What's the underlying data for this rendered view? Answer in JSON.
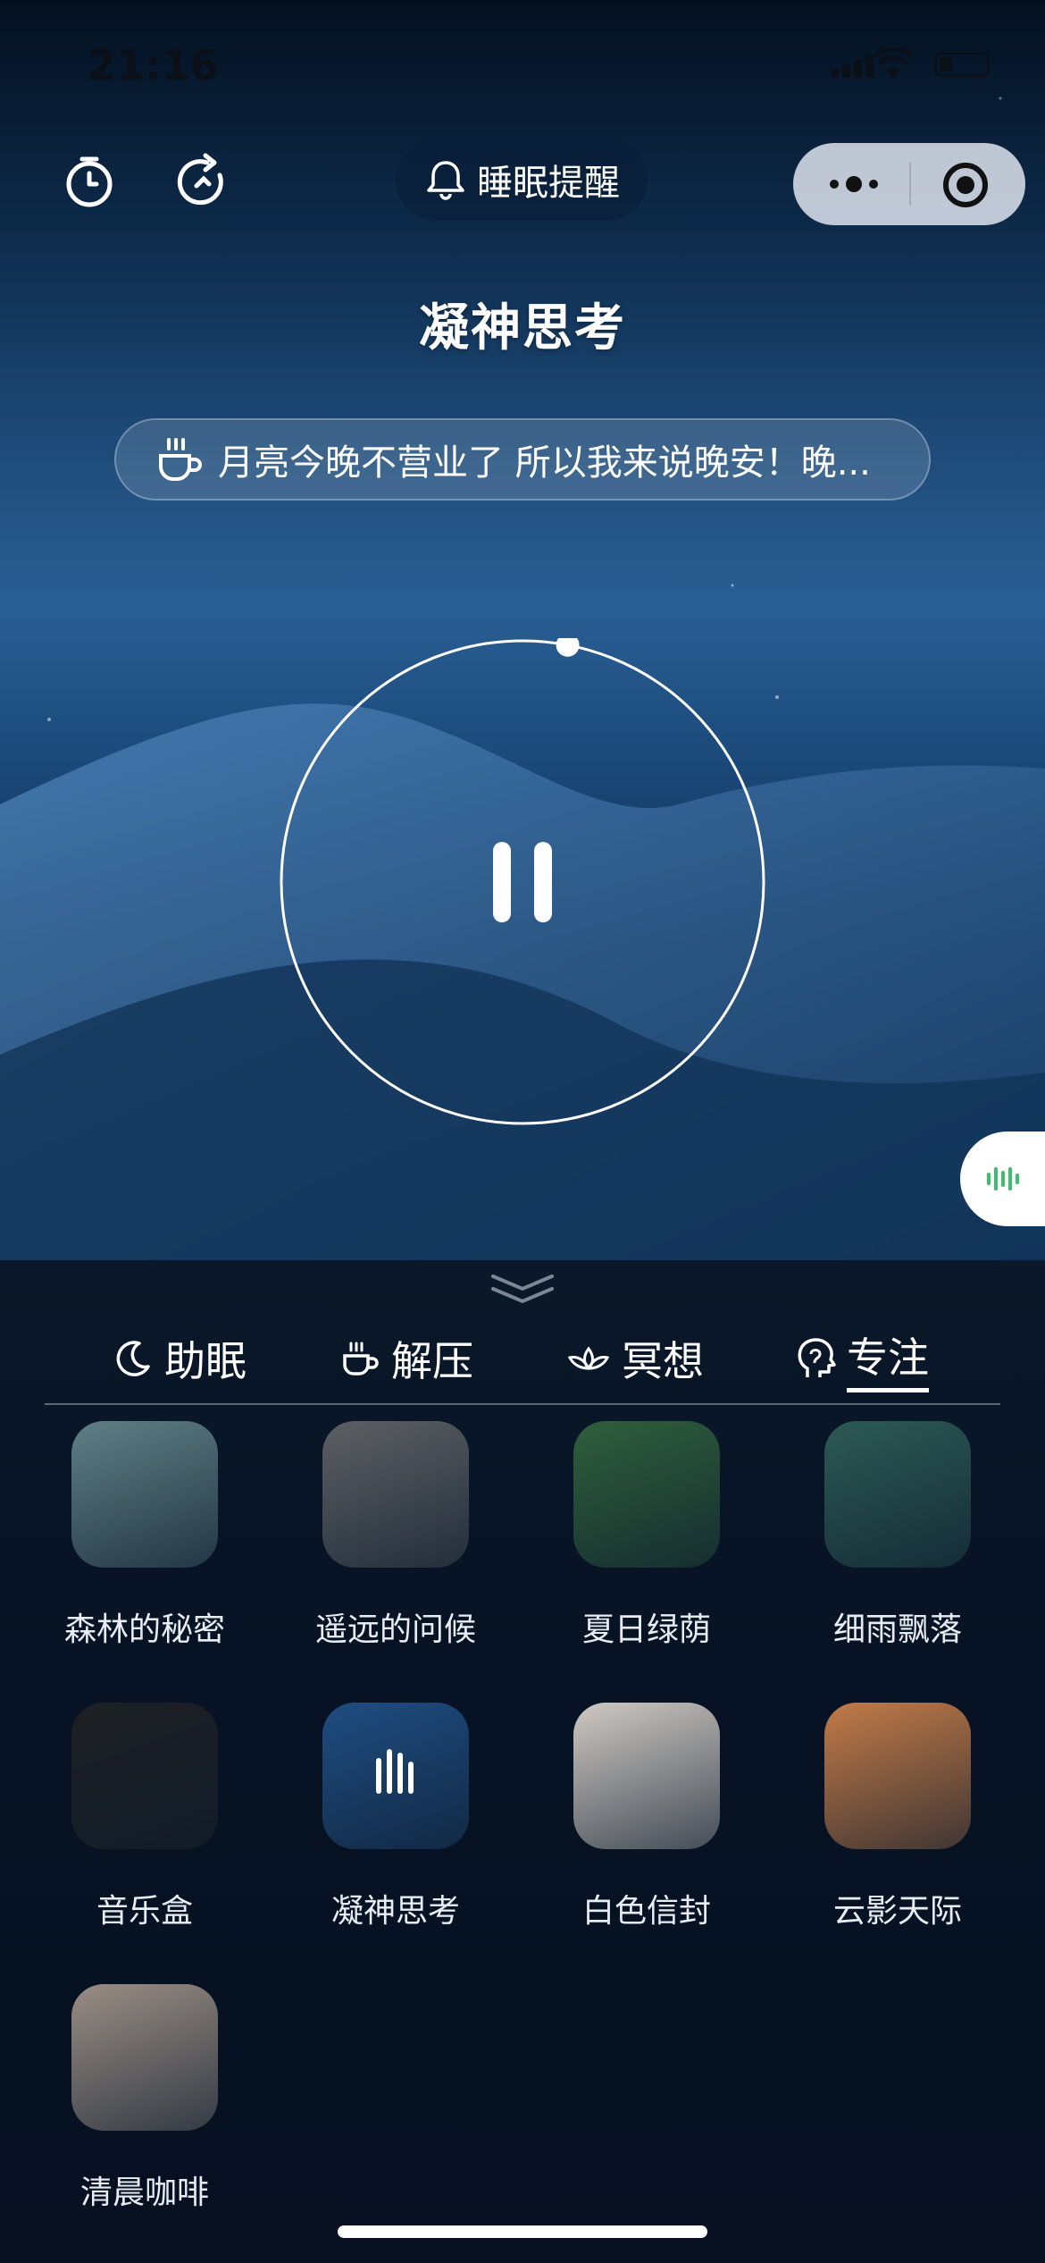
{
  "status_bar": {
    "time": "21:16"
  },
  "top_bar": {
    "timer_icon": "timer-icon",
    "replay_icon": "replay-icon",
    "reminder_label": "睡眠提醒",
    "more_icon": "more-dots-icon",
    "target_icon": "record-icon"
  },
  "player": {
    "title": "凝神思考",
    "message": "月亮今晚不营业了 所以我来说晚安！晚...",
    "state": "playing",
    "progress": 0.03
  },
  "tabs": [
    {
      "label": "助眠",
      "icon": "moon-icon",
      "active": false
    },
    {
      "label": "解压",
      "icon": "cup-icon",
      "active": false
    },
    {
      "label": "冥想",
      "icon": "lotus-icon",
      "active": false
    },
    {
      "label": "专注",
      "icon": "head-icon",
      "active": true
    }
  ],
  "tracks": [
    {
      "label": "森林的秘密",
      "color": "#5f7f86"
    },
    {
      "label": "遥远的问候",
      "color": "#5d6064"
    },
    {
      "label": "夏日绿荫",
      "color": "#2f5f3c"
    },
    {
      "label": "细雨飘落",
      "color": "#2c5a55"
    },
    {
      "label": "音乐盒",
      "color": "#1e2024"
    },
    {
      "label": "凝神思考",
      "color": "#1f4d82"
    },
    {
      "label": "白色信封",
      "color": "#cfc9c3"
    },
    {
      "label": "云影天际",
      "color": "#c27b48"
    },
    {
      "label": "清晨咖啡",
      "color": "#9a8d84"
    }
  ]
}
